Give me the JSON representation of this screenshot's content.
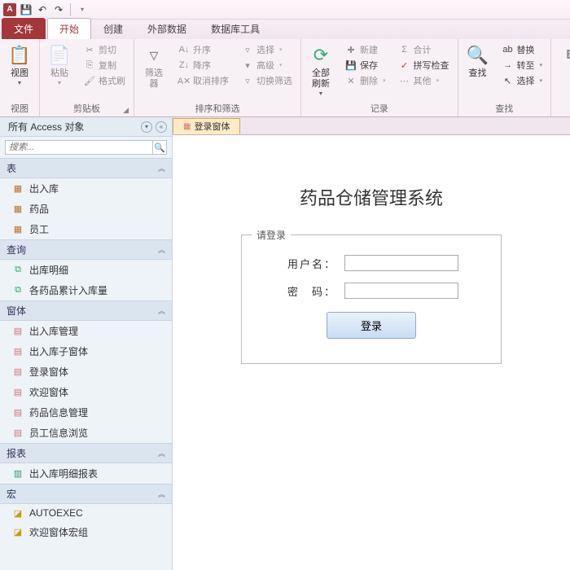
{
  "qat": {
    "save": "💾",
    "undo": "↶",
    "redo": "↷"
  },
  "tabs": {
    "file": "文件",
    "items": [
      "开始",
      "创建",
      "外部数据",
      "数据库工具"
    ],
    "active": 0
  },
  "ribbon": {
    "groups": {
      "view": {
        "label": "视图",
        "btn": "视图"
      },
      "clipboard": {
        "label": "剪贴板",
        "paste": "粘贴",
        "cut": "剪切",
        "copy": "复制",
        "format": "格式刷"
      },
      "sortfilter": {
        "label": "排序和筛选",
        "filter": "筛选器",
        "asc": "升序",
        "desc": "降序",
        "clear": "取消排序",
        "sel": "选择",
        "adv": "高级",
        "toggle": "切换筛选"
      },
      "records": {
        "label": "记录",
        "refresh": "全部刷新",
        "new": "新建",
        "save": "保存",
        "del": "删除",
        "sum": "合计",
        "spell": "拼写检查",
        "more": "其他"
      },
      "find": {
        "label": "查找",
        "find": "查找",
        "replace": "替换",
        "goto": "转至",
        "select": "选择"
      }
    }
  },
  "nav": {
    "title": "所有 Access 对象",
    "search_placeholder": "搜索...",
    "groups": [
      {
        "name": "表",
        "icon": "table",
        "items": [
          "出入库",
          "药品",
          "员工"
        ]
      },
      {
        "name": "查询",
        "icon": "query",
        "items": [
          "出库明细",
          "各药品累计入库量"
        ]
      },
      {
        "name": "窗体",
        "icon": "form",
        "items": [
          "出入库管理",
          "出入库子窗体",
          "登录窗体",
          "欢迎窗体",
          "药品信息管理",
          "员工信息浏览"
        ]
      },
      {
        "name": "报表",
        "icon": "report",
        "items": [
          "出入库明细报表"
        ]
      },
      {
        "name": "宏",
        "icon": "macro",
        "items": [
          "AUTOEXEC",
          "欢迎窗体宏组"
        ]
      }
    ]
  },
  "doc": {
    "tab": "登录窗体",
    "title": "药品仓储管理系统",
    "legend": "请登录",
    "username": "用户名：",
    "password": "密　码：",
    "login": "登录"
  }
}
